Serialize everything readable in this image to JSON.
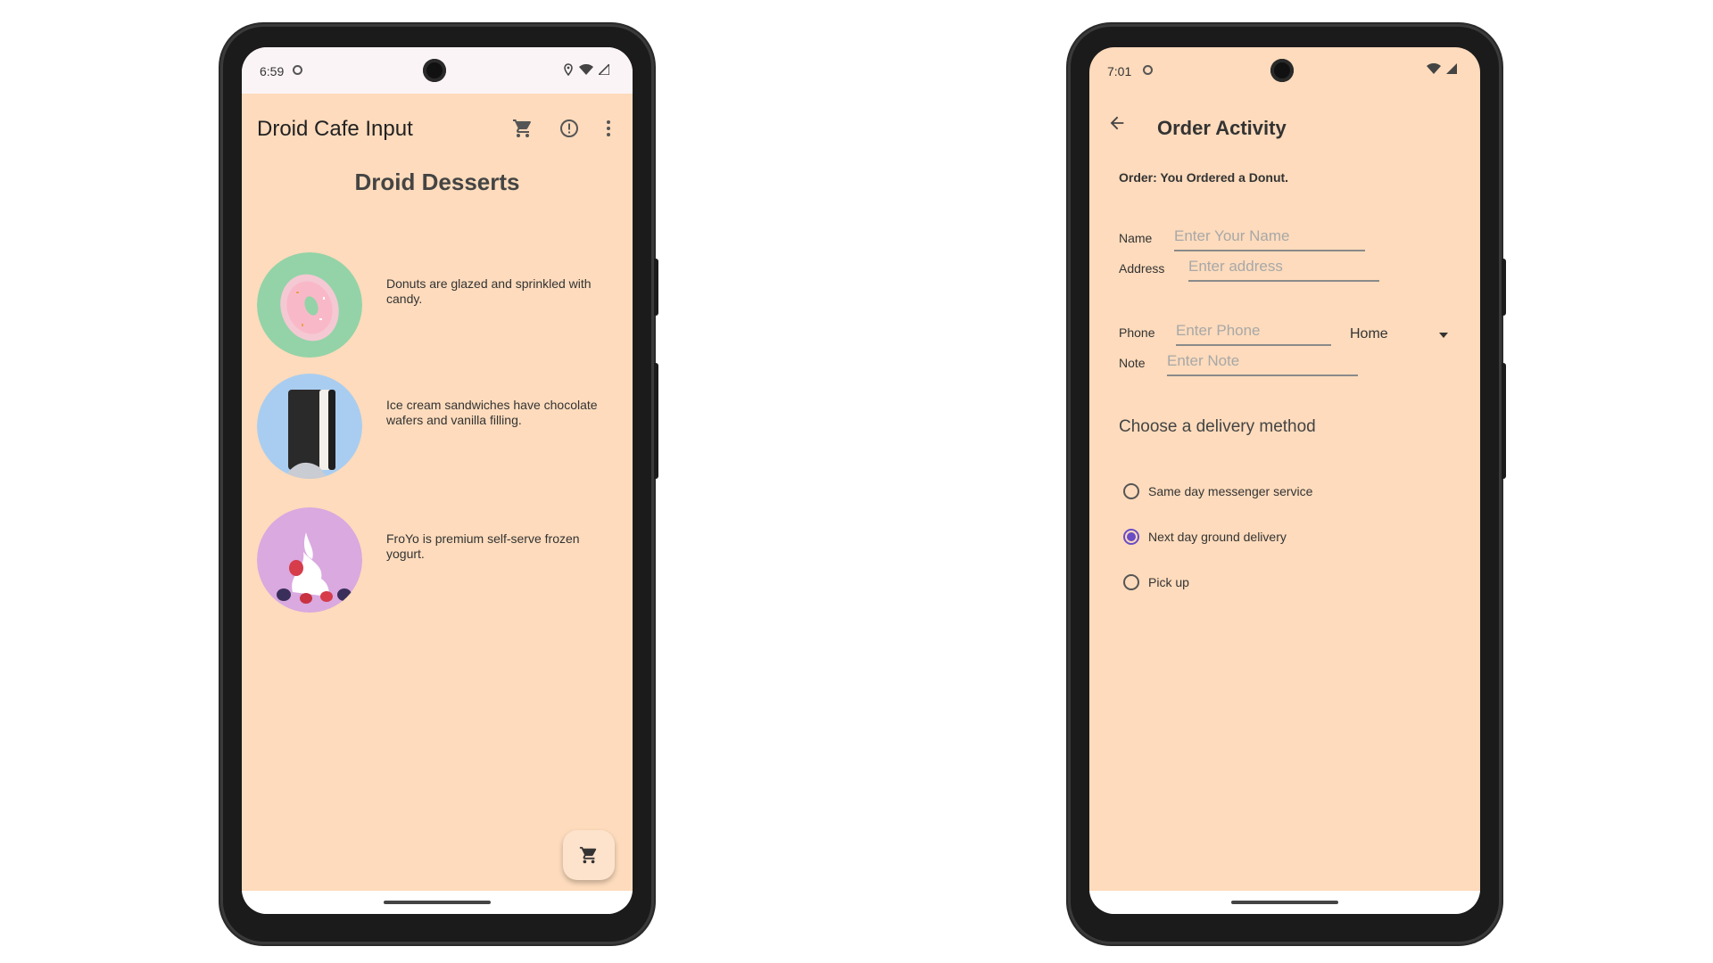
{
  "left_phone": {
    "status": {
      "time": "6:59"
    },
    "appbar": {
      "title": "Droid Cafe Input",
      "icons": [
        "cart-icon",
        "info-icon",
        "more-vert-icon"
      ]
    },
    "section_title": "Droid Desserts",
    "items": [
      {
        "name": "donut",
        "description": "Donuts are glazed and sprinkled with candy."
      },
      {
        "name": "ice-cream-sandwich",
        "description": "Ice cream sandwiches have chocolate wafers and vanilla filling."
      },
      {
        "name": "froyo",
        "description": "FroYo is premium self-serve frozen yogurt."
      }
    ],
    "fab_icon": "cart-icon"
  },
  "right_phone": {
    "status": {
      "time": "7:01"
    },
    "appbar": {
      "title": "Order Activity",
      "back_icon": "arrow-back-icon"
    },
    "order_summary": "Order: You Ordered a Donut.",
    "form": {
      "name_label": "Name",
      "name_placeholder": "Enter Your Name",
      "address_label": "Address",
      "address_placeholder": "Enter address",
      "phone_label": "Phone",
      "phone_placeholder": "Enter Phone",
      "phone_type": "Home",
      "note_label": "Note",
      "note_placeholder": "Enter Note"
    },
    "delivery": {
      "heading": "Choose a delivery method",
      "options": [
        {
          "label": "Same day messenger service",
          "selected": false
        },
        {
          "label": "Next day ground delivery",
          "selected": true
        },
        {
          "label": "Pick up",
          "selected": false
        }
      ]
    }
  },
  "colors": {
    "screen_background": "#fddbbc",
    "accent": "#6a4cc6"
  }
}
